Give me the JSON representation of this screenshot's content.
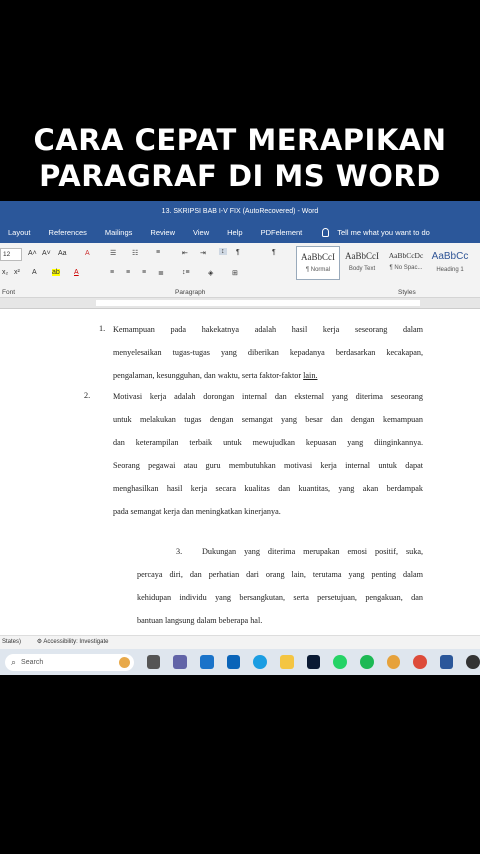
{
  "caption": {
    "line1": "CARA CEPAT MERAPIKAN",
    "line2": "PARAGRAF DI MS WORD"
  },
  "titlebar": {
    "title": "13. SKRIPSI BAB I-V FIX (AutoRecovered) - Word"
  },
  "menu": {
    "items": [
      "Layout",
      "References",
      "Mailings",
      "Review",
      "View",
      "Help",
      "PDFelement"
    ],
    "tell_me": "Tell me what you want to do"
  },
  "ribbon": {
    "font_size": "12",
    "groups": {
      "font": "Font",
      "paragraph": "Paragraph",
      "styles": "Styles"
    },
    "styles": [
      {
        "sample": "AaBbCcI",
        "name": "¶ Normal"
      },
      {
        "sample": "AaBbCcI",
        "name": "Body Text"
      },
      {
        "sample": "AaBbCcDc",
        "name": "¶ No Spac..."
      },
      {
        "sample": "AaBbCc",
        "name": "Heading 1"
      }
    ]
  },
  "document": {
    "item1_number": "1.",
    "item1_lines": [
      "Kemampuan pada hakekatnya adalah hasil kerja seseorang dalam",
      "menyelesaikan tugas-tugas yang diberikan kepadanya berdasarkan kecakapan,",
      "pengalaman, kesungguhan, dan waktu, serta faktor-faktor",
      "lain."
    ],
    "item2_number": "2.",
    "item2_lines": [
      "Motivasi kerja adalah dorongan internal dan eksternal yang diterima seseorang",
      "untuk melakukan tugas dengan semangat yang besar dan dengan kemampuan",
      "dan keterampilan terbaik untuk mewujudkan kepuasan yang diinginkannya.",
      "Seorang pegawai atau guru membutuhkan motivasi kerja internal untuk dapat",
      "menghasilkan hasil kerja secara kualitas dan kuantitas, yang akan berdampak",
      "pada semangat kerja dan meningkatkan kinerjanya."
    ],
    "item3_number": "3.",
    "item3_first": "Dukungan yang diterima merupakan emosi positif, suka,",
    "item3_lines": [
      "percaya diri, dan perhatian dari orang lain, terutama yang penting dalam",
      "kehidupan individu yang bersangkutan, serta persetujuan, pengakuan, dan",
      "bantuan langsung dalam beberapa hal."
    ]
  },
  "status": {
    "left": "States)",
    "accessibility": "Accessibility: Investigate"
  },
  "taskbar": {
    "search_placeholder": "Search"
  },
  "colors": {
    "word_blue": "#2b579a",
    "taskbar": "#dfe6ee"
  }
}
